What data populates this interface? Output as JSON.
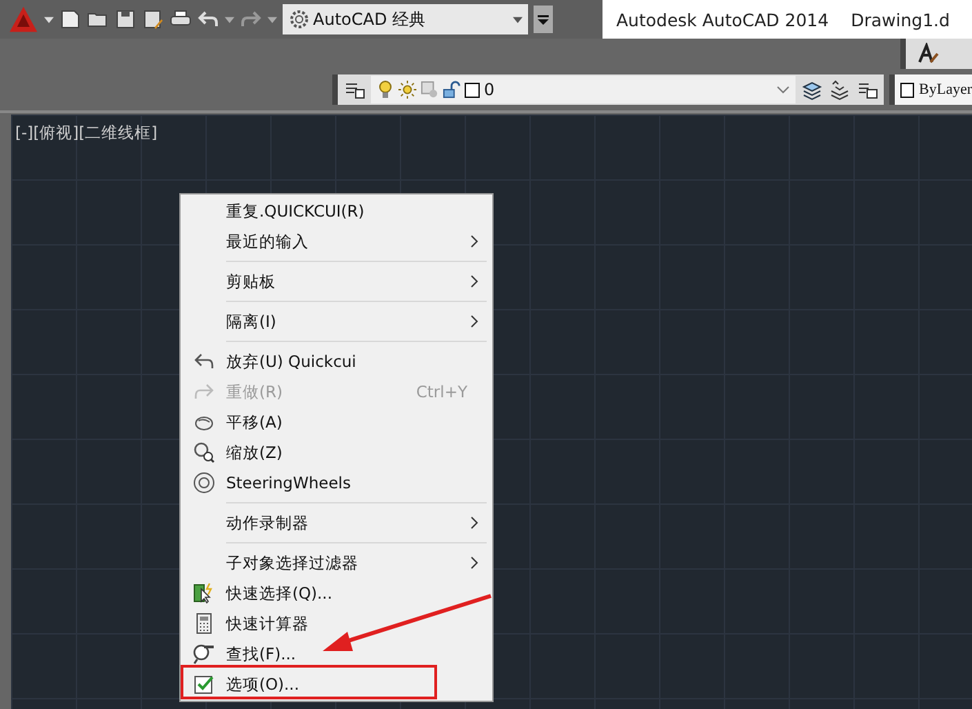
{
  "toolbar": {
    "workspace": "AutoCAD 经典"
  },
  "title_bar": {
    "app": "Autodesk AutoCAD 2014",
    "document": "Drawing1.d"
  },
  "layer_toolbar": {
    "layer": "0",
    "color_control": "ByLayer"
  },
  "viewport": {
    "label": "[-][俯视][二维线框]"
  },
  "context_menu": [
    {
      "kind": "item",
      "label": "重复.QUICKCUI(R)",
      "submenu": false,
      "disabled": false
    },
    {
      "kind": "item",
      "label": "最近的输入",
      "submenu": true,
      "disabled": false
    },
    {
      "kind": "separator"
    },
    {
      "kind": "item",
      "label": "剪贴板",
      "submenu": true,
      "disabled": false
    },
    {
      "kind": "separator"
    },
    {
      "kind": "item",
      "label": "隔离(I)",
      "submenu": true,
      "disabled": false
    },
    {
      "kind": "separator"
    },
    {
      "kind": "item",
      "label": "放弃(U) Quickcui",
      "submenu": false,
      "disabled": false
    },
    {
      "kind": "item",
      "label": "重做(R)",
      "shortcut": "Ctrl+Y",
      "submenu": false,
      "disabled": true
    },
    {
      "kind": "item",
      "label": "平移(A)",
      "submenu": false,
      "disabled": false
    },
    {
      "kind": "item",
      "label": "缩放(Z)",
      "submenu": false,
      "disabled": false
    },
    {
      "kind": "item",
      "label": "SteeringWheels",
      "submenu": false,
      "disabled": false
    },
    {
      "kind": "separator"
    },
    {
      "kind": "item",
      "label": "动作录制器",
      "submenu": true,
      "disabled": false
    },
    {
      "kind": "separator"
    },
    {
      "kind": "item",
      "label": "子对象选择过滤器",
      "submenu": true,
      "disabled": false
    },
    {
      "kind": "item",
      "label": "快速选择(Q)...",
      "submenu": false,
      "disabled": false
    },
    {
      "kind": "item",
      "label": "快速计算器",
      "submenu": false,
      "disabled": false
    },
    {
      "kind": "item",
      "label": "查找(F)...",
      "submenu": false,
      "disabled": false
    },
    {
      "kind": "item",
      "label": "选项(O)...",
      "submenu": false,
      "disabled": false
    }
  ]
}
